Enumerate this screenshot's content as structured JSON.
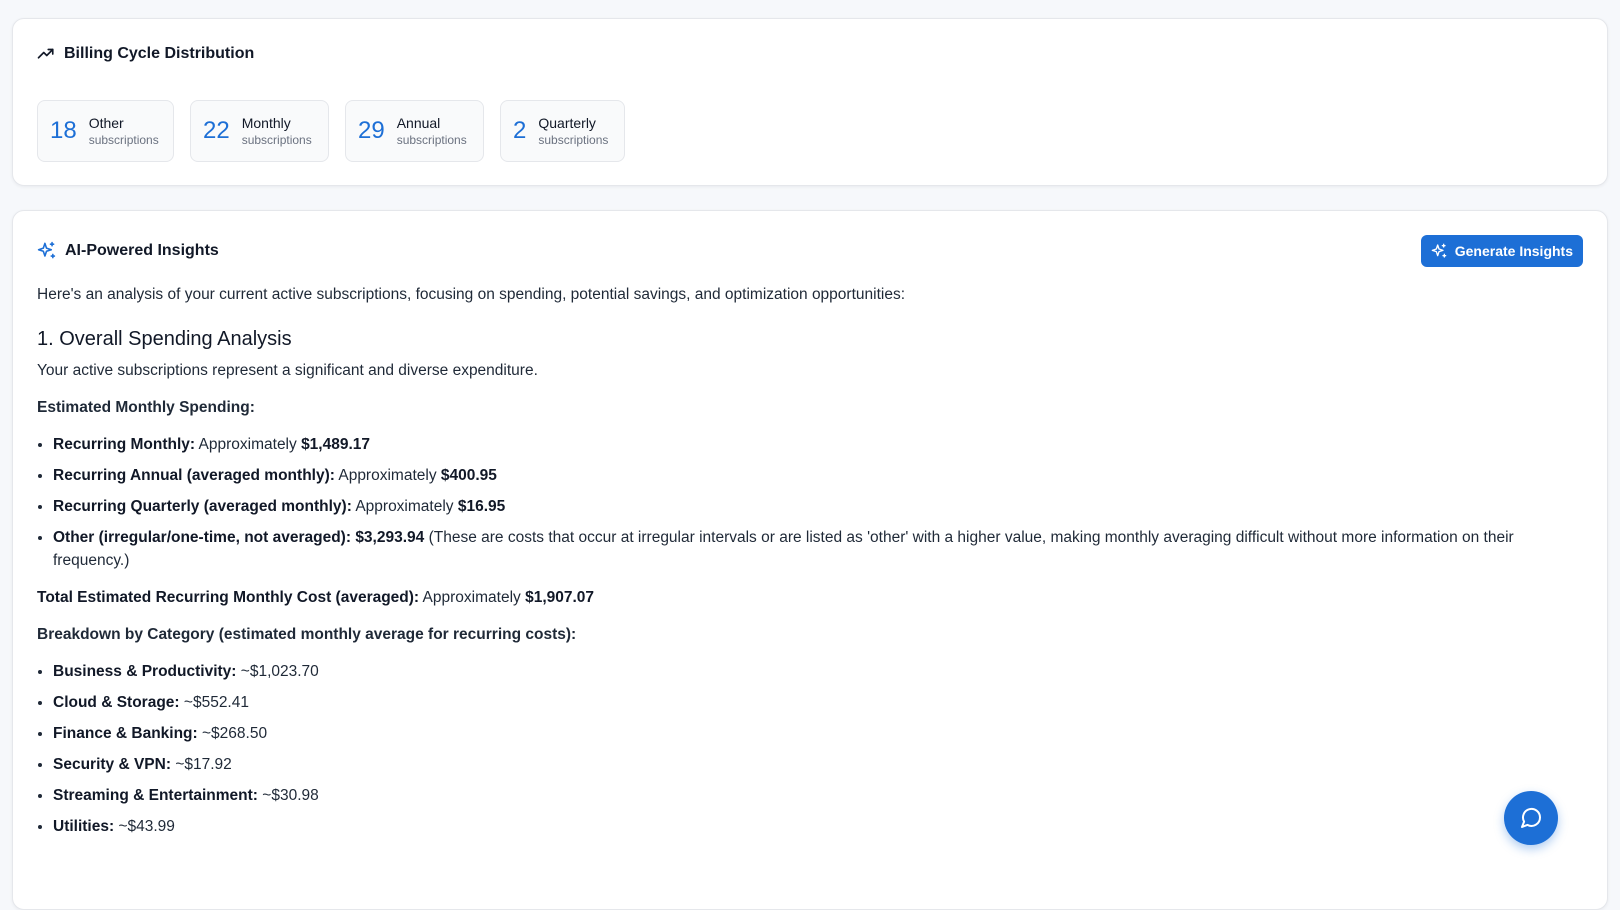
{
  "billing": {
    "title": "Billing Cycle Distribution",
    "stats": [
      {
        "count": "18",
        "label": "Other",
        "sub": "subscriptions"
      },
      {
        "count": "22",
        "label": "Monthly",
        "sub": "subscriptions"
      },
      {
        "count": "29",
        "label": "Annual",
        "sub": "subscriptions"
      },
      {
        "count": "2",
        "label": "Quarterly",
        "sub": "subscriptions"
      }
    ]
  },
  "insights": {
    "title": "AI-Powered Insights",
    "generate_label": "Generate Insights",
    "intro": "Here's an analysis of your current active subscriptions, focusing on spending, potential savings, and optimization opportunities:",
    "section1_heading": "1. Overall Spending Analysis",
    "section1_para": "Your active subscriptions represent a significant and diverse expenditure.",
    "monthly_heading": "Estimated Monthly Spending:",
    "monthly_items": [
      {
        "label": "Recurring Monthly:",
        "pre": " Approximately ",
        "value": "$1,489.17",
        "post": ""
      },
      {
        "label": "Recurring Annual (averaged monthly):",
        "pre": " Approximately ",
        "value": "$400.95",
        "post": ""
      },
      {
        "label": "Recurring Quarterly (averaged monthly):",
        "pre": " Approximately ",
        "value": "$16.95",
        "post": ""
      },
      {
        "label": "Other (irregular/one-time, not averaged):",
        "pre": " ",
        "value": "$3,293.94",
        "post": " (These are costs that occur at irregular intervals or are listed as 'other' with a higher value, making monthly averaging difficult without more information on their frequency.)"
      }
    ],
    "total_label": "Total Estimated Recurring Monthly Cost (averaged):",
    "total_pre": " Approximately ",
    "total_value": "$1,907.07",
    "category_heading": "Breakdown by Category (estimated monthly average for recurring costs):",
    "category_items": [
      {
        "label": "Business & Productivity:",
        "value": " ~$1,023.70"
      },
      {
        "label": "Cloud & Storage:",
        "value": " ~$552.41"
      },
      {
        "label": "Finance & Banking:",
        "value": " ~$268.50"
      },
      {
        "label": "Security & VPN:",
        "value": " ~$17.92"
      },
      {
        "label": "Streaming & Entertainment:",
        "value": " ~$30.98"
      },
      {
        "label": "Utilities:",
        "value": " ~$43.99"
      }
    ]
  },
  "colors": {
    "accent": "#1d6fd6",
    "background": "#f6f8fb"
  },
  "icons": {
    "billing": "trending-up-icon",
    "insights": "sparkles-icon",
    "chat": "chat-bubble-icon"
  }
}
